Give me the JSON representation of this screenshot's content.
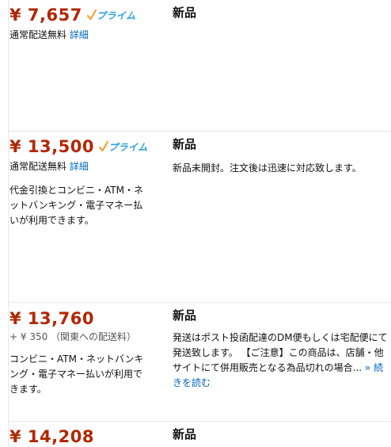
{
  "offers": [
    {
      "price": "¥ 7,657",
      "prime_label": "プライム",
      "shipping": "通常配送無料",
      "details_link": "詳細",
      "condition": "新品"
    },
    {
      "price": "¥ 13,500",
      "prime_label": "プライム",
      "shipping": "通常配送無料",
      "details_link": "詳細",
      "payment": "代金引換とコンビニ・ATM・ネットバンキング・電子マネー払いが利用できます。",
      "condition": "新品",
      "comment": "新品未開封。注文後は迅速に対応致します。"
    },
    {
      "price": "¥ 13,760",
      "shipping_fee": "+ ¥ 350 （関東への配送料）",
      "payment": "コンビニ・ATM・ネットバンキング・電子マネー払いが利用できます。",
      "condition": "新品",
      "comment": "発送はポスト投函配達のDM便もしくは宅配便にて発送致します。 【ご注意】この商品は、店舗・他サイトにて併用販売となる為品切れの場合...",
      "read_more": "続きを読む"
    },
    {
      "price": "¥ 14,208",
      "condition": "新品"
    }
  ],
  "colors": {
    "price": "#b12704",
    "link": "#0066c0",
    "prime": "#2a9fd6",
    "check": "#f3a847"
  }
}
